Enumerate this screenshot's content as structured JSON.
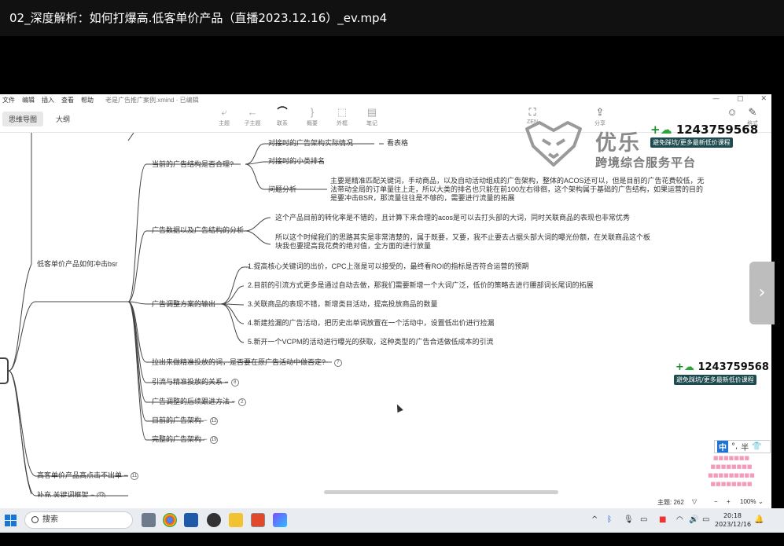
{
  "video": {
    "title": "02_深度解析：如何打爆高.低客单价产品（直播2023.12.16）_ev.mp4"
  },
  "menu": {
    "items": [
      "文件",
      "编辑",
      "插入",
      "查看",
      "帮助"
    ],
    "document": "老是广告推广案例.xmind · 已编辑"
  },
  "window": {
    "minimize": "—",
    "restore": "▢",
    "close": "✕"
  },
  "modes": [
    {
      "label": "思维导图"
    },
    {
      "label": "大纲"
    }
  ],
  "toolbar": {
    "topic": "主题",
    "subtopic": "子主题",
    "relation": "联系",
    "summary": "概要",
    "boundary": "外框",
    "note": "笔记",
    "zen": "ZEN",
    "share": "分享",
    "format": "格式"
  },
  "mindmap": {
    "root_child": "低客单价产品如何冲击bsr",
    "b1": "当前的广告结构是否合理?",
    "b1_1": "对接时的广告架构实际情况",
    "b1_1_1": "看表格",
    "b1_2": "对接时的小类排名",
    "b1_3": "问题分析",
    "b1_3_1": "主要是精准匹配关键词，手动商品，以及自动活动组成的广告架构，整体的ACOS还可以，但是目前的广告花费较低，无法带动全局的订单量往上走，所以大类的排名也只能在前100左右徘徊，这个架构属于基础的广告结构，如果运营的目的是要冲击BSR，那流量往往是不够的，需要进行流量的拓展",
    "b2": "广告数据以及广告结构的分析",
    "b2_1": "这个产品目前的转化率是不错的，且计算下来合理的acos是可以去打头部的大词，同时关联商品的表现也非常优秀",
    "b2_2": "所以这个时候我们的思路其实是非常清楚的，属于既要，又要，我不止要去占据头部大词的曝光份额，在关联商品这个板块我也要提高我花费的绝对值，全方面的进行放量",
    "b3": "广告调整方案的输出",
    "b3_1": "1.提高核心关键词的出价，CPC上涨是可以接受的，最终看ROI的指标是否符合运营的预期",
    "b3_2": "2.目前的引流方式更多是通过自动去做，那我们需要新增一个大词广泛，低价的策略去进行腰部词长尾词的拓展",
    "b3_3": "3.关联商品的表现不错，新增类目活动，提高投放商品的数量",
    "b3_4": "4.新建捡漏的广告活动，把历史出单词放置在一个活动中，设置低出价进行捡漏",
    "b3_5": "5.新开一个VCPM的活动进行曝光的获取，这种类型的广告合适做低成本的引流",
    "b4": "拉出来做精准投放的词，是否要在原广告活动中做否定?",
    "b4_badge": "7",
    "b5": "引流与精准投放的关系",
    "b5_badge": "8",
    "b6": "广告调整的后续跟进方法",
    "b6_badge": "2",
    "b7": "目前的广告架构",
    "b7_badge": "12",
    "b8": "完整的广告架构",
    "b8_badge": "19",
    "r2": "高客单价产品高点击不出单",
    "r2_badge": "11",
    "r3": "补充 关键词框架",
    "r3_badge": "43"
  },
  "status": {
    "topics": "主题: 262",
    "zoom_minus": "−",
    "zoom_plus": "+",
    "zoom": "100%"
  },
  "watermark": {
    "brand": "优乐",
    "brand_sub": "跨境综合服务平台",
    "phone_plus": "+",
    "phone": "1243759568",
    "promo": "避免踩坑/更多最新低价课程",
    "phone2": "1243759568",
    "promo2": "避免踩坑/更多最新低价课程"
  },
  "ime": {
    "lang": "中",
    "punct": "°,",
    "half": "半",
    "shirt": "👕"
  },
  "taskbar": {
    "search": "搜索",
    "time": "20:18",
    "date": "2023/12/16"
  }
}
